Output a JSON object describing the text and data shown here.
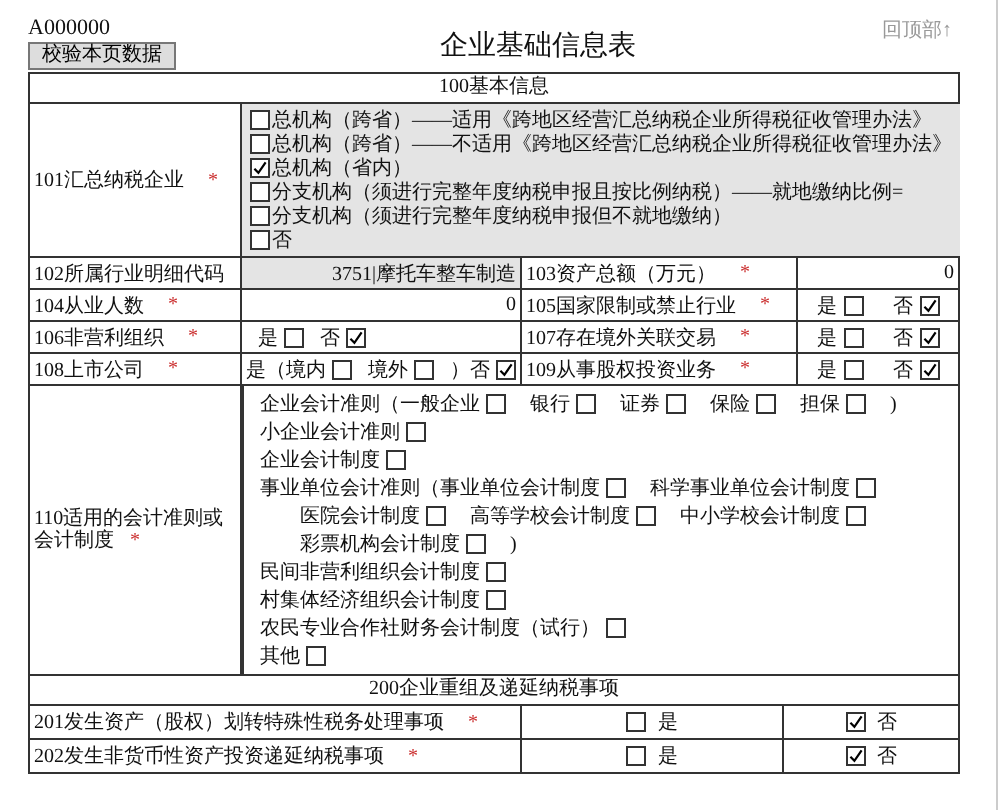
{
  "form_code": "A000000",
  "validate_button": "校验本页数据",
  "title": "企业基础信息表",
  "top_link": "回顶部↑",
  "section_100": {
    "title": "100基本信息",
    "row_101": {
      "label": "101汇总纳税企业",
      "mark": "*",
      "options": [
        {
          "label": "总机构（跨省）——适用《跨地区经营汇总纳税企业所得税征收管理办法》",
          "checked": false
        },
        {
          "label": "总机构（跨省）——不适用《跨地区经营汇总纳税企业所得税征收管理办法》",
          "checked": false
        },
        {
          "label": "总机构（省内）",
          "checked": true
        },
        {
          "label": "分支机构（须进行完整年度纳税申报且按比例纳税）——就地缴纳比例=",
          "checked": false
        },
        {
          "label": "分支机构（须进行完整年度纳税申报但不就地缴纳）",
          "checked": false
        },
        {
          "label": "否",
          "checked": false
        }
      ]
    },
    "pair_rows": [
      {
        "left": {
          "label": "102所属行业明细代码",
          "kind": "value",
          "value": "3751|摩托车整车制造",
          "shaded": true
        },
        "right": {
          "label": "103资产总额（万元）",
          "mark": "*",
          "kind": "value",
          "value": "0"
        }
      },
      {
        "left": {
          "label": "104从业人数",
          "mark": "*",
          "kind": "value",
          "value": "0"
        },
        "right": {
          "label": "105国家限制或禁止行业",
          "mark": "*",
          "kind": "checks",
          "items": [
            {
              "label": "是",
              "checked": false
            },
            {
              "label": "否",
              "checked": true
            }
          ]
        }
      },
      {
        "left": {
          "label": "106非营利组织",
          "mark": "*",
          "kind": "checks",
          "items": [
            {
              "label": "是",
              "checked": false
            },
            {
              "label": "否",
              "checked": true
            }
          ]
        },
        "right": {
          "label": "107存在境外关联交易",
          "mark": "*",
          "kind": "checks",
          "items": [
            {
              "label": "是",
              "checked": false
            },
            {
              "label": "否",
              "checked": true
            }
          ]
        }
      },
      {
        "left": {
          "label": "108上市公司",
          "mark": "*",
          "kind": "checks",
          "items": [
            {
              "label": "是（境内",
              "checked": false
            },
            {
              "label": "境外",
              "checked": false
            },
            {
              "label": "）否",
              "checked": true
            }
          ]
        },
        "right": {
          "label": "109从事股权投资业务",
          "mark": "*",
          "kind": "checks",
          "items": [
            {
              "label": "是",
              "checked": false
            },
            {
              "label": "否",
              "checked": true
            }
          ]
        }
      }
    ],
    "row_110": {
      "label": "110适用的会计准则或会计制度",
      "mark": "*",
      "lines": [
        {
          "items": [
            {
              "kind": "check",
              "label": "企业会计准则（一般企业",
              "checked": false
            },
            {
              "kind": "check",
              "label": "银行",
              "checked": false
            },
            {
              "kind": "check",
              "label": "证券",
              "checked": false
            },
            {
              "kind": "check",
              "label": "保险",
              "checked": false
            },
            {
              "kind": "check",
              "label": "担保",
              "checked": false
            },
            {
              "kind": "text",
              "label": ")"
            }
          ]
        },
        {
          "items": [
            {
              "kind": "check",
              "label": "小企业会计准则",
              "checked": false
            }
          ]
        },
        {
          "items": [
            {
              "kind": "check",
              "label": "企业会计制度",
              "checked": false
            }
          ]
        },
        {
          "items": [
            {
              "kind": "check",
              "label": "事业单位会计准则（事业单位会计制度",
              "checked": false
            },
            {
              "kind": "check",
              "label": "科学事业单位会计制度",
              "checked": false
            }
          ],
          "children": [
            {
              "items": [
                {
                  "kind": "check",
                  "label": "医院会计制度",
                  "checked": false
                },
                {
                  "kind": "check",
                  "label": "高等学校会计制度",
                  "checked": false
                },
                {
                  "kind": "check",
                  "label": "中小学校会计制度",
                  "checked": false
                }
              ]
            },
            {
              "items": [
                {
                  "kind": "check",
                  "label": "彩票机构会计制度",
                  "checked": false
                },
                {
                  "kind": "text",
                  "label": ")"
                }
              ]
            }
          ]
        },
        {
          "items": [
            {
              "kind": "check",
              "label": "民间非营利组织会计制度",
              "checked": false
            }
          ]
        },
        {
          "items": [
            {
              "kind": "check",
              "label": "村集体经济组织会计制度",
              "checked": false
            }
          ]
        },
        {
          "items": [
            {
              "kind": "check",
              "label": "农民专业合作社财务会计制度（试行）",
              "checked": false
            }
          ]
        },
        {
          "items": [
            {
              "kind": "check",
              "label": "其他",
              "checked": false
            }
          ]
        }
      ]
    }
  },
  "section_200": {
    "title": "200企业重组及递延纳税事项",
    "rows": [
      {
        "label": "201发生资产（股权）划转特殊性税务处理事项",
        "mark": "*",
        "options": [
          {
            "label": "是",
            "checked": false
          },
          {
            "label": "否",
            "checked": true
          }
        ]
      },
      {
        "label": "202发生非货币性资产投资递延纳税事项",
        "mark": "*",
        "options": [
          {
            "label": "是",
            "checked": false
          },
          {
            "label": "否",
            "checked": true
          }
        ]
      }
    ]
  }
}
